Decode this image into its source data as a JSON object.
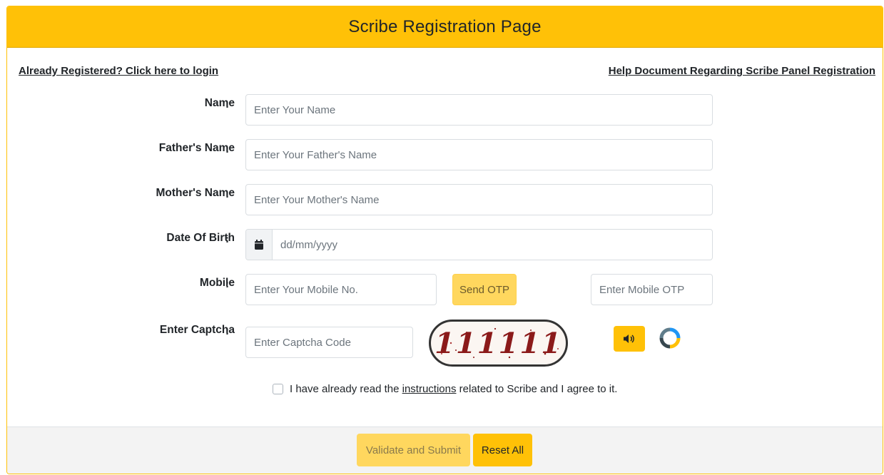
{
  "header": {
    "title": "Scribe Registration Page"
  },
  "links": {
    "login": "Already Registered? Click here to login",
    "help": "Help Document Regarding Scribe Panel Registration"
  },
  "form": {
    "colon": ":",
    "name": {
      "label": "Name",
      "placeholder": "Enter Your Name"
    },
    "father": {
      "label": "Father's Name",
      "placeholder": "Enter Your Father's Name"
    },
    "mother": {
      "label": "Mother's Name",
      "placeholder": "Enter Your Mother's Name"
    },
    "dob": {
      "label": "Date Of Birth",
      "placeholder": "dd/mm/yyyy",
      "icon": "calendar-icon"
    },
    "mobile": {
      "label": "Mobile",
      "placeholder": "Enter Your Mobile No.",
      "send_otp": "Send OTP",
      "otp_placeholder": "Enter Mobile OTP"
    },
    "captcha": {
      "label": "Enter Captcha",
      "placeholder": "Enter Captcha Code",
      "image_text": "111111",
      "audio_icon": "speaker-icon",
      "refresh_icon": "refresh-icon"
    },
    "agree": {
      "prefix": "I have already read the",
      "link": "instructions",
      "suffix": "related to Scribe and I agree to it.",
      "checked": false
    }
  },
  "footer": {
    "submit": "Validate and Submit",
    "reset": "Reset All"
  },
  "colors": {
    "accent": "#ffc107",
    "accent_light": "#ffd75e",
    "footer_bg": "#f3f3f3"
  }
}
